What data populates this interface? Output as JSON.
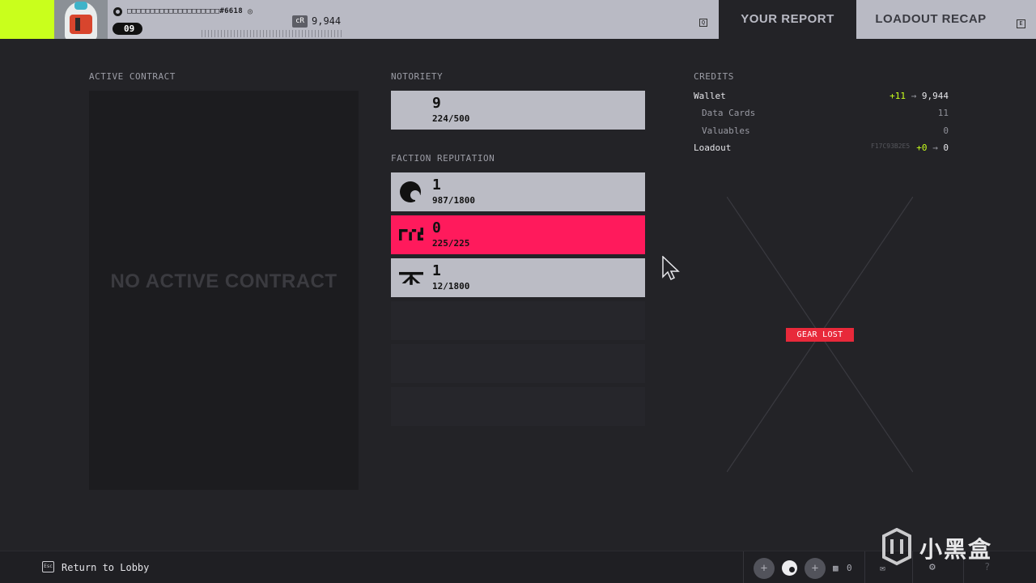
{
  "header": {
    "player_name": "□□□□□□□□□□□□□□□□□□□□#6618",
    "level": "09",
    "currency_code": "cR",
    "currency_amount": "9,944",
    "key_q": "Q",
    "key_e": "E",
    "tabs": [
      {
        "label": "YOUR REPORT",
        "active": true
      },
      {
        "label": "LOADOUT RECAP",
        "active": false
      }
    ],
    "accent_color": "#c9ff1c"
  },
  "active_contract": {
    "label": "ACTIVE CONTRACT",
    "empty_text": "NO ACTIVE CONTRACT"
  },
  "notoriety": {
    "label": "NOTORIETY",
    "value": "9",
    "progress": "224/500"
  },
  "faction_reputation": {
    "label": "FACTION REPUTATION",
    "factions": [
      {
        "icon": "faction-circle-icon",
        "value": "1",
        "progress": "987/1800",
        "highlighted": false
      },
      {
        "icon": "faction-glyph-icon",
        "value": "0",
        "progress": "225/225",
        "highlighted": true,
        "color": "#ff1a5c"
      },
      {
        "icon": "faction-bar-icon",
        "value": "1",
        "progress": "12/1800",
        "highlighted": false
      }
    ]
  },
  "credits": {
    "label": "CREDITS",
    "wallet": {
      "label": "Wallet",
      "delta": "+11",
      "total": "9,944"
    },
    "data_cards": {
      "label": "Data Cards",
      "value": "11"
    },
    "valuables": {
      "label": "Valuables",
      "value": "0"
    },
    "loadout": {
      "label": "Loadout",
      "delta": "+0",
      "total": "0"
    },
    "hash": "F17C93B2E5"
  },
  "gear_lost_badge": "GEAR LOST",
  "footer": {
    "esc_key": "Esc",
    "return_label": "Return to Lobby",
    "squad_count": "0"
  },
  "watermark": "小黑盒"
}
